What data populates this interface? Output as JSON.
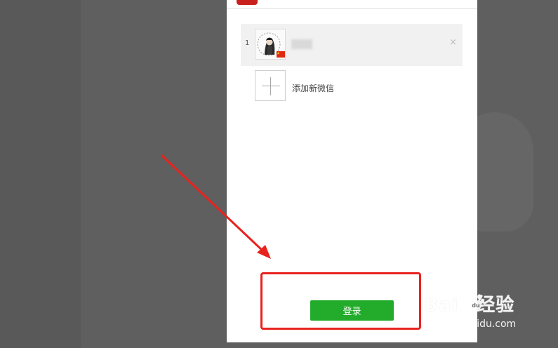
{
  "account_list": {
    "accounts": [
      {
        "index": "1"
      }
    ],
    "remove_symbol": "×",
    "add_label": "添加新微信"
  },
  "login": {
    "label": "登录"
  },
  "watermark": {
    "brand_prefix": "Bai",
    "brand_suffix": "经验",
    "url": "jingyan.baidu.com"
  },
  "colors": {
    "login_green": "#23ab2b",
    "annotation_red": "#e8231e",
    "backdrop": "#5f5f5f"
  },
  "icons": {
    "app_logo": "app-logo-icon",
    "avatar": "avatar-image",
    "flag": "flag-icon",
    "add": "plus-icon",
    "remove": "close-icon"
  }
}
